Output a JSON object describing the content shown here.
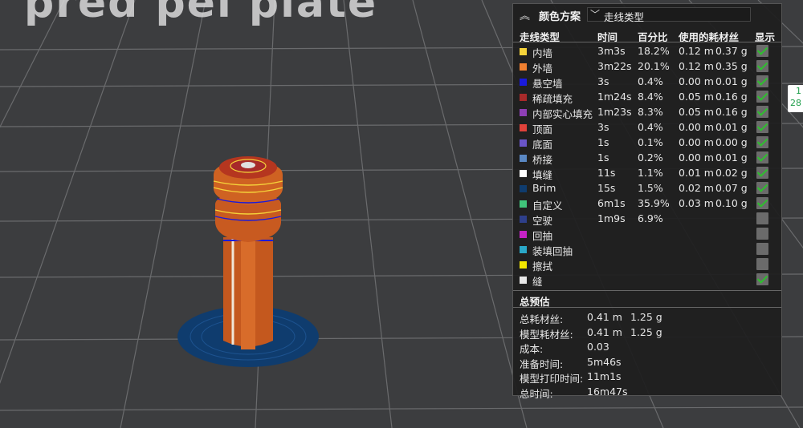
{
  "bed_text": "pred pei plate",
  "side_tag": {
    "line1": "1",
    "line2": "28"
  },
  "panel": {
    "scheme_label": "颜色方案",
    "dropdown_value": "走线类型",
    "headers": {
      "type": "走线类型",
      "time": "时间",
      "percent": "百分比",
      "filament": "使用的耗材丝",
      "show": "显示"
    },
    "rows": [
      {
        "name": "内墙",
        "time": "3m3s",
        "percent": "18.2%",
        "length": "0.12 m",
        "weight": "0.37 g",
        "color": "#f5d33a",
        "shown": true
      },
      {
        "name": "外墙",
        "time": "3m22s",
        "percent": "20.1%",
        "length": "0.12 m",
        "weight": "0.35 g",
        "color": "#f08030",
        "shown": true
      },
      {
        "name": "悬空墙",
        "time": "3s",
        "percent": "0.4%",
        "length": "0.00 m",
        "weight": "0.01 g",
        "color": "#1a1adb",
        "shown": true
      },
      {
        "name": "稀疏填充",
        "time": "1m24s",
        "percent": "8.4%",
        "length": "0.05 m",
        "weight": "0.16 g",
        "color": "#a72a2a",
        "shown": true
      },
      {
        "name": "内部实心填充",
        "time": "1m23s",
        "percent": "8.3%",
        "length": "0.05 m",
        "weight": "0.16 g",
        "color": "#8e3fb5",
        "shown": true
      },
      {
        "name": "顶面",
        "time": "3s",
        "percent": "0.4%",
        "length": "0.00 m",
        "weight": "0.01 g",
        "color": "#e0423a",
        "shown": true
      },
      {
        "name": "底面",
        "time": "1s",
        "percent": "0.1%",
        "length": "0.00 m",
        "weight": "0.00 g",
        "color": "#6a55c8",
        "shown": true
      },
      {
        "name": "桥接",
        "time": "1s",
        "percent": "0.2%",
        "length": "0.00 m",
        "weight": "0.01 g",
        "color": "#5a88c4",
        "shown": true
      },
      {
        "name": "填缝",
        "time": "11s",
        "percent": "1.1%",
        "length": "0.01 m",
        "weight": "0.02 g",
        "color": "#ffffff",
        "shown": true
      },
      {
        "name": "Brim",
        "time": "15s",
        "percent": "1.5%",
        "length": "0.02 m",
        "weight": "0.07 g",
        "color": "#0f3c6e",
        "shown": true
      },
      {
        "name": "自定义",
        "time": "6m1s",
        "percent": "35.9%",
        "length": "0.03 m",
        "weight": "0.10 g",
        "color": "#40c47a",
        "shown": true
      },
      {
        "name": "空驶",
        "time": "1m9s",
        "percent": "6.9%",
        "length": "",
        "weight": "",
        "color": "#2e3f8a",
        "shown": false
      },
      {
        "name": "回抽",
        "time": "",
        "percent": "",
        "length": "",
        "weight": "",
        "color": "#c522c5",
        "shown": false
      },
      {
        "name": "装填回抽",
        "time": "",
        "percent": "",
        "length": "",
        "weight": "",
        "color": "#2aa8c8",
        "shown": false
      },
      {
        "name": "擦拭",
        "time": "",
        "percent": "",
        "length": "",
        "weight": "",
        "color": "#f2e600",
        "shown": false
      },
      {
        "name": "缝",
        "time": "",
        "percent": "",
        "length": "",
        "weight": "",
        "color": "#e8e8e8",
        "shown": true
      }
    ],
    "summary_title": "总预估",
    "summary": [
      {
        "label": "总耗材丝:",
        "v1": "0.41 m",
        "v2": "1.25 g"
      },
      {
        "label": "模型耗材丝:",
        "v1": "0.41 m",
        "v2": "1.25 g"
      },
      {
        "label": "成本:",
        "v1": "0.03",
        "v2": ""
      },
      {
        "label": "准备时间:",
        "v1": "5m46s",
        "v2": ""
      },
      {
        "label": "模型打印时间:",
        "v1": "11m1s",
        "v2": ""
      },
      {
        "label": "总时间:",
        "v1": "16m47s",
        "v2": ""
      }
    ]
  }
}
